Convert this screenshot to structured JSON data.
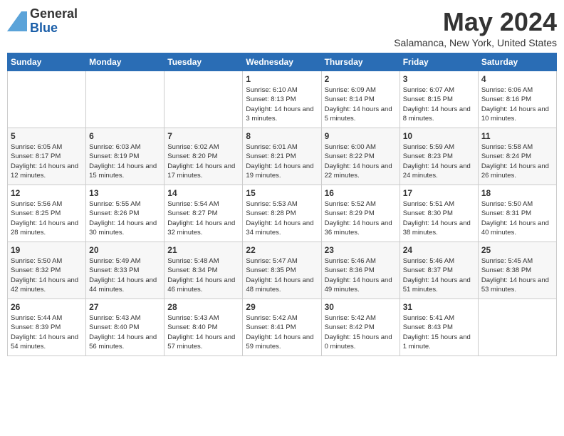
{
  "header": {
    "title": "May 2024",
    "location": "Salamanca, New York, United States",
    "logo_general": "General",
    "logo_blue": "Blue"
  },
  "days_of_week": [
    "Sunday",
    "Monday",
    "Tuesday",
    "Wednesday",
    "Thursday",
    "Friday",
    "Saturday"
  ],
  "weeks": [
    [
      {
        "day": null
      },
      {
        "day": null
      },
      {
        "day": null
      },
      {
        "day": "1",
        "sunrise": "Sunrise: 6:10 AM",
        "sunset": "Sunset: 8:13 PM",
        "daylight": "Daylight: 14 hours and 3 minutes."
      },
      {
        "day": "2",
        "sunrise": "Sunrise: 6:09 AM",
        "sunset": "Sunset: 8:14 PM",
        "daylight": "Daylight: 14 hours and 5 minutes."
      },
      {
        "day": "3",
        "sunrise": "Sunrise: 6:07 AM",
        "sunset": "Sunset: 8:15 PM",
        "daylight": "Daylight: 14 hours and 8 minutes."
      },
      {
        "day": "4",
        "sunrise": "Sunrise: 6:06 AM",
        "sunset": "Sunset: 8:16 PM",
        "daylight": "Daylight: 14 hours and 10 minutes."
      }
    ],
    [
      {
        "day": "5",
        "sunrise": "Sunrise: 6:05 AM",
        "sunset": "Sunset: 8:17 PM",
        "daylight": "Daylight: 14 hours and 12 minutes."
      },
      {
        "day": "6",
        "sunrise": "Sunrise: 6:03 AM",
        "sunset": "Sunset: 8:19 PM",
        "daylight": "Daylight: 14 hours and 15 minutes."
      },
      {
        "day": "7",
        "sunrise": "Sunrise: 6:02 AM",
        "sunset": "Sunset: 8:20 PM",
        "daylight": "Daylight: 14 hours and 17 minutes."
      },
      {
        "day": "8",
        "sunrise": "Sunrise: 6:01 AM",
        "sunset": "Sunset: 8:21 PM",
        "daylight": "Daylight: 14 hours and 19 minutes."
      },
      {
        "day": "9",
        "sunrise": "Sunrise: 6:00 AM",
        "sunset": "Sunset: 8:22 PM",
        "daylight": "Daylight: 14 hours and 22 minutes."
      },
      {
        "day": "10",
        "sunrise": "Sunrise: 5:59 AM",
        "sunset": "Sunset: 8:23 PM",
        "daylight": "Daylight: 14 hours and 24 minutes."
      },
      {
        "day": "11",
        "sunrise": "Sunrise: 5:58 AM",
        "sunset": "Sunset: 8:24 PM",
        "daylight": "Daylight: 14 hours and 26 minutes."
      }
    ],
    [
      {
        "day": "12",
        "sunrise": "Sunrise: 5:56 AM",
        "sunset": "Sunset: 8:25 PM",
        "daylight": "Daylight: 14 hours and 28 minutes."
      },
      {
        "day": "13",
        "sunrise": "Sunrise: 5:55 AM",
        "sunset": "Sunset: 8:26 PM",
        "daylight": "Daylight: 14 hours and 30 minutes."
      },
      {
        "day": "14",
        "sunrise": "Sunrise: 5:54 AM",
        "sunset": "Sunset: 8:27 PM",
        "daylight": "Daylight: 14 hours and 32 minutes."
      },
      {
        "day": "15",
        "sunrise": "Sunrise: 5:53 AM",
        "sunset": "Sunset: 8:28 PM",
        "daylight": "Daylight: 14 hours and 34 minutes."
      },
      {
        "day": "16",
        "sunrise": "Sunrise: 5:52 AM",
        "sunset": "Sunset: 8:29 PM",
        "daylight": "Daylight: 14 hours and 36 minutes."
      },
      {
        "day": "17",
        "sunrise": "Sunrise: 5:51 AM",
        "sunset": "Sunset: 8:30 PM",
        "daylight": "Daylight: 14 hours and 38 minutes."
      },
      {
        "day": "18",
        "sunrise": "Sunrise: 5:50 AM",
        "sunset": "Sunset: 8:31 PM",
        "daylight": "Daylight: 14 hours and 40 minutes."
      }
    ],
    [
      {
        "day": "19",
        "sunrise": "Sunrise: 5:50 AM",
        "sunset": "Sunset: 8:32 PM",
        "daylight": "Daylight: 14 hours and 42 minutes."
      },
      {
        "day": "20",
        "sunrise": "Sunrise: 5:49 AM",
        "sunset": "Sunset: 8:33 PM",
        "daylight": "Daylight: 14 hours and 44 minutes."
      },
      {
        "day": "21",
        "sunrise": "Sunrise: 5:48 AM",
        "sunset": "Sunset: 8:34 PM",
        "daylight": "Daylight: 14 hours and 46 minutes."
      },
      {
        "day": "22",
        "sunrise": "Sunrise: 5:47 AM",
        "sunset": "Sunset: 8:35 PM",
        "daylight": "Daylight: 14 hours and 48 minutes."
      },
      {
        "day": "23",
        "sunrise": "Sunrise: 5:46 AM",
        "sunset": "Sunset: 8:36 PM",
        "daylight": "Daylight: 14 hours and 49 minutes."
      },
      {
        "day": "24",
        "sunrise": "Sunrise: 5:46 AM",
        "sunset": "Sunset: 8:37 PM",
        "daylight": "Daylight: 14 hours and 51 minutes."
      },
      {
        "day": "25",
        "sunrise": "Sunrise: 5:45 AM",
        "sunset": "Sunset: 8:38 PM",
        "daylight": "Daylight: 14 hours and 53 minutes."
      }
    ],
    [
      {
        "day": "26",
        "sunrise": "Sunrise: 5:44 AM",
        "sunset": "Sunset: 8:39 PM",
        "daylight": "Daylight: 14 hours and 54 minutes."
      },
      {
        "day": "27",
        "sunrise": "Sunrise: 5:43 AM",
        "sunset": "Sunset: 8:40 PM",
        "daylight": "Daylight: 14 hours and 56 minutes."
      },
      {
        "day": "28",
        "sunrise": "Sunrise: 5:43 AM",
        "sunset": "Sunset: 8:40 PM",
        "daylight": "Daylight: 14 hours and 57 minutes."
      },
      {
        "day": "29",
        "sunrise": "Sunrise: 5:42 AM",
        "sunset": "Sunset: 8:41 PM",
        "daylight": "Daylight: 14 hours and 59 minutes."
      },
      {
        "day": "30",
        "sunrise": "Sunrise: 5:42 AM",
        "sunset": "Sunset: 8:42 PM",
        "daylight": "Daylight: 15 hours and 0 minutes."
      },
      {
        "day": "31",
        "sunrise": "Sunrise: 5:41 AM",
        "sunset": "Sunset: 8:43 PM",
        "daylight": "Daylight: 15 hours and 1 minute."
      },
      {
        "day": null
      }
    ]
  ]
}
